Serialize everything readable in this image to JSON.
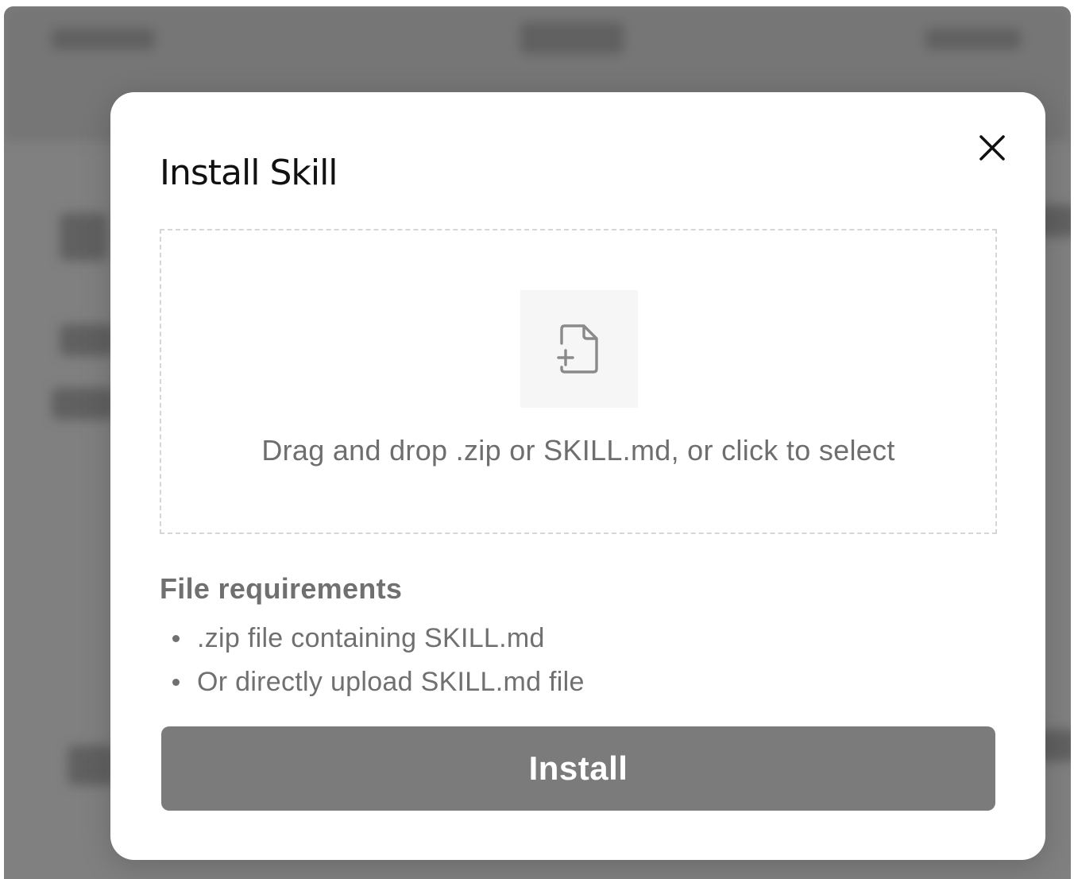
{
  "modal": {
    "title": "Install Skill",
    "close_icon": "close-icon",
    "dropzone": {
      "icon": "file-plus-icon",
      "text": "Drag and drop .zip or SKILL.md, or click to select"
    },
    "requirements": {
      "title": "File requirements",
      "items": [
        ".zip file containing SKILL.md",
        "Or directly upload SKILL.md file"
      ]
    },
    "install_label": "Install"
  },
  "colors": {
    "overlay": "#8a8a8a",
    "button_disabled": "#7b7b7b",
    "muted_text": "#707070"
  }
}
